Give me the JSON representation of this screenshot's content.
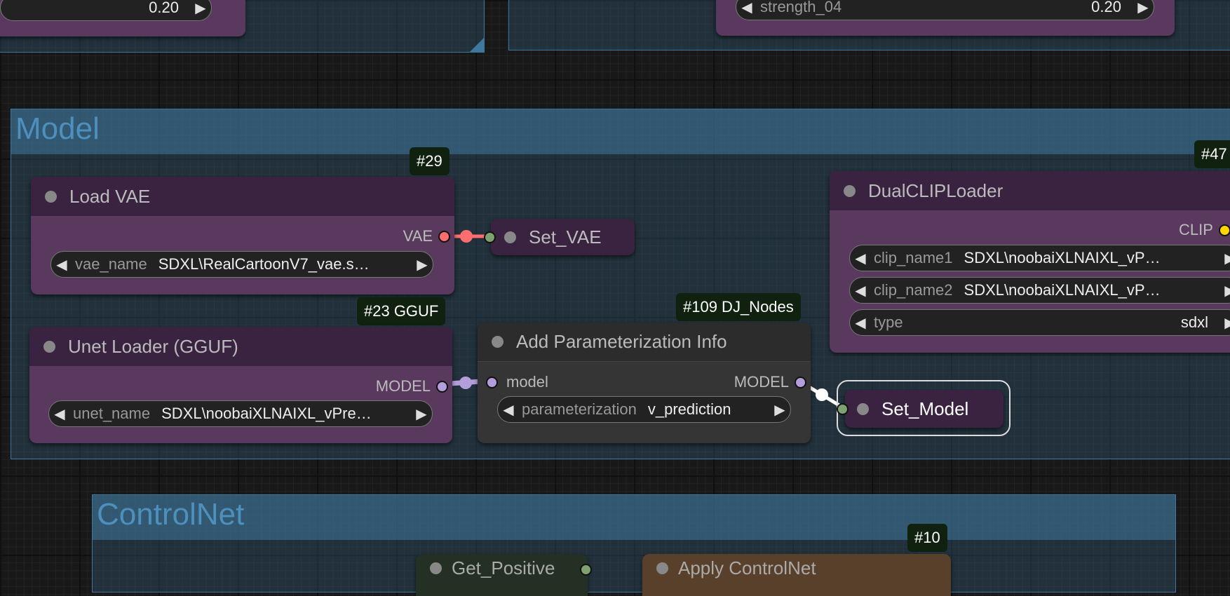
{
  "top_left_node": {
    "widget_value": "0.20"
  },
  "top_right_node": {
    "widget_label": "strength_04",
    "widget_value": "0.20"
  },
  "groups": {
    "model": "Model",
    "controlnet": "ControlNet"
  },
  "load_vae": {
    "badge": "#29",
    "title": "Load VAE",
    "output": "VAE",
    "widget_label": "vae_name",
    "widget_value": "SDXL\\RealCartoonV7_vae.s…"
  },
  "set_vae": {
    "title": "Set_VAE"
  },
  "unet_loader": {
    "badge": "#23 GGUF",
    "title": "Unet Loader (GGUF)",
    "output": "MODEL",
    "widget_label": "unet_name",
    "widget_value": "SDXL\\noobaiXLNAIXL_vPre…"
  },
  "add_param": {
    "badge": "#109 DJ_Nodes",
    "title": "Add Parameterization Info",
    "input": "model",
    "output": "MODEL",
    "widget_label": "parameterization",
    "widget_value": "v_prediction"
  },
  "set_model": {
    "title": "Set_Model"
  },
  "dual_clip": {
    "badge": "#47",
    "title": "DualCLIPLoader",
    "output": "CLIP",
    "widgets": [
      {
        "label": "clip_name1",
        "value": "SDXL\\noobaiXLNAIXL_vP…"
      },
      {
        "label": "clip_name2",
        "value": "SDXL\\noobaiXLNAIXL_vP…"
      },
      {
        "label": "type",
        "value": "sdxl"
      }
    ]
  },
  "controlnet_badge": "#10",
  "get_positive": {
    "title": "Get_Positive"
  },
  "apply_controlnet": {
    "title": "Apply ControlNet"
  },
  "arrows": {
    "left": "◀",
    "right": "▶"
  },
  "colors": {
    "vae": "#ff6e6e",
    "model": "#b39ddb",
    "clip": "#ffd500",
    "link_green": "#7fa070"
  }
}
